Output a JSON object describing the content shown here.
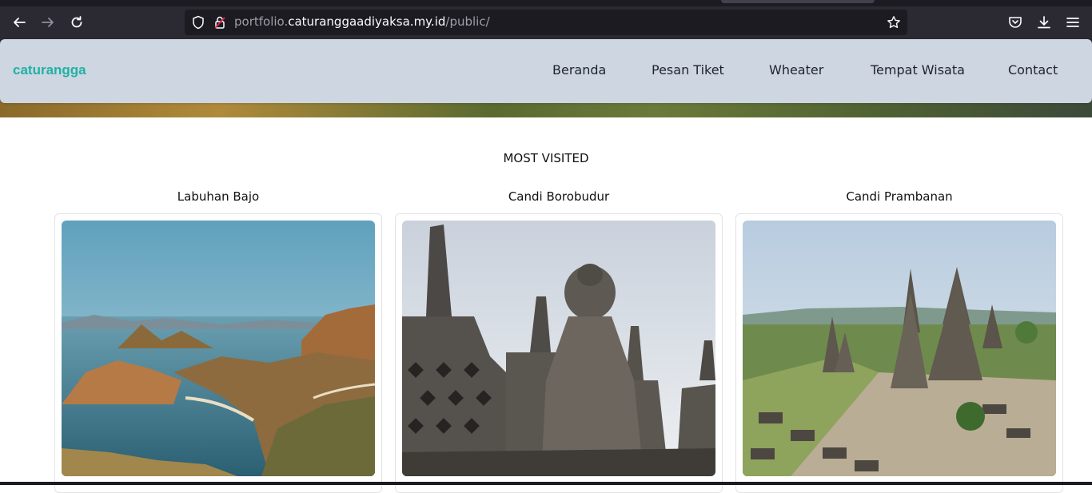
{
  "browser": {
    "url_prefix": "portfolio.",
    "url_domain": "caturanggaadiyaksa.my.id",
    "url_path": "/public/"
  },
  "nav": {
    "brand": "caturangga",
    "links": [
      "Beranda",
      "Pesan Tiket",
      "Wheater",
      "Tempat Wisata",
      "Contact"
    ]
  },
  "content": {
    "section_title": "MOST VISITED",
    "cards": [
      {
        "title": "Labuhan Bajo"
      },
      {
        "title": "Candi Borobudur"
      },
      {
        "title": "Candi Prambanan"
      }
    ]
  },
  "colors": {
    "brand": "#20b2a3",
    "navbar_bg": "#cdd6e1",
    "browser_bg": "#2b2a33"
  }
}
